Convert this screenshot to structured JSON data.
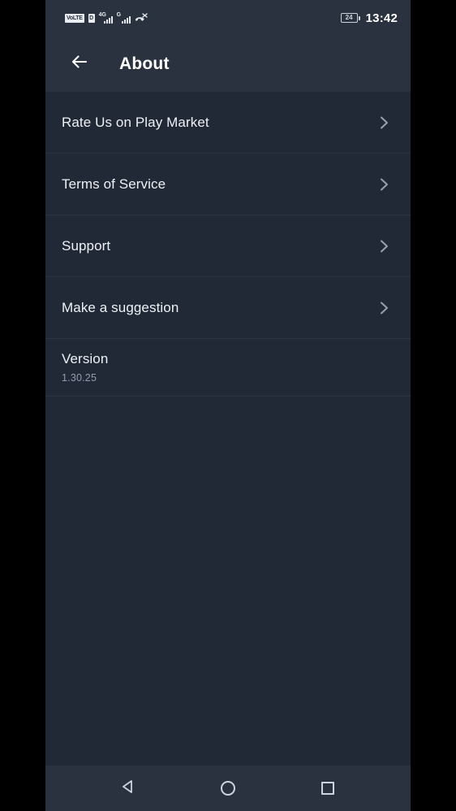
{
  "status_bar": {
    "volte_badge": "VoLTE",
    "data_badge": "D",
    "network_1": "4G",
    "network_2": "G",
    "missed_call_icon": "missed-call-icon",
    "battery_level": "24",
    "time": "13:42"
  },
  "app_bar": {
    "back_icon": "arrow-left-icon",
    "title": "About"
  },
  "list": {
    "items": [
      {
        "label": "Rate Us on Play Market",
        "chevron": "chevron-right-icon",
        "has_chevron": true,
        "sub": ""
      },
      {
        "label": "Terms of Service",
        "chevron": "chevron-right-icon",
        "has_chevron": true,
        "sub": ""
      },
      {
        "label": "Support",
        "chevron": "chevron-right-icon",
        "has_chevron": true,
        "sub": ""
      },
      {
        "label": "Make a suggestion",
        "chevron": "chevron-right-icon",
        "has_chevron": true,
        "sub": ""
      },
      {
        "label": "Version",
        "chevron": "",
        "has_chevron": false,
        "sub": "1.30.25"
      }
    ]
  },
  "nav_bar": {
    "back_label": "back-triangle-icon",
    "home_label": "home-circle-icon",
    "recents_label": "recents-square-icon"
  },
  "colors": {
    "app_bar_bg": "#2a3240",
    "body_bg": "#212836",
    "divider": "#2c3442",
    "primary_text": "#eef1f5",
    "secondary_text": "#949db0",
    "letterbox": "#000000"
  }
}
